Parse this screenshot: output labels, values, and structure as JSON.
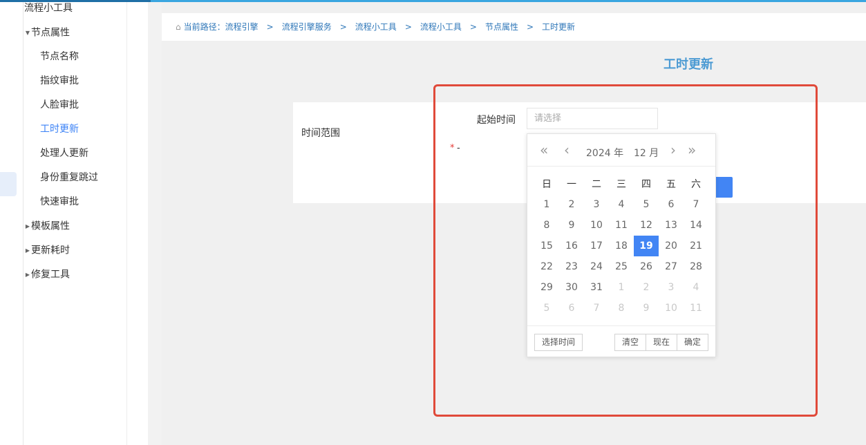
{
  "sidebar": {
    "root": "流程小工具",
    "groups": [
      {
        "label": "节点属性",
        "expanded": true,
        "items": [
          "节点名称",
          "指纹审批",
          "人脸审批",
          "工时更新",
          "处理人更新",
          "身份重复跳过",
          "快速审批"
        ]
      },
      {
        "label": "模板属性",
        "expanded": false
      },
      {
        "label": "更新耗时",
        "expanded": false
      },
      {
        "label": "修复工具",
        "expanded": false
      }
    ],
    "active_item": "工时更新"
  },
  "breadcrumb": {
    "prefix": "当前路径：",
    "items": [
      "流程引擎",
      "流程引擎服务",
      "流程小工具",
      "流程小工具",
      "节点属性",
      "工时更新"
    ],
    "separator": ">"
  },
  "page": {
    "title": "工时更新"
  },
  "form": {
    "range_label": "时间范围",
    "start_label": "起始时间",
    "start_placeholder": "请选择",
    "required_mark": "*",
    "dash": "-"
  },
  "datepicker": {
    "year": "2024 年",
    "month": "12 月",
    "nav": {
      "prev_year": "«",
      "prev_month": "‹",
      "next_month": "›",
      "next_year": "»"
    },
    "weekdays": [
      "日",
      "一",
      "二",
      "三",
      "四",
      "五",
      "六"
    ],
    "weeks": [
      [
        "1",
        "2",
        "3",
        "4",
        "5",
        "6",
        "7"
      ],
      [
        "8",
        "9",
        "10",
        "11",
        "12",
        "13",
        "14"
      ],
      [
        "15",
        "16",
        "17",
        "18",
        "19",
        "20",
        "21"
      ],
      [
        "22",
        "23",
        "24",
        "25",
        "26",
        "27",
        "28"
      ],
      [
        "29",
        "30",
        "31",
        "1",
        "2",
        "3",
        "4"
      ],
      [
        "5",
        "6",
        "7",
        "8",
        "9",
        "10",
        "11"
      ]
    ],
    "selected_day": "19",
    "footer": {
      "select_time": "选择时间",
      "clear": "清空",
      "now": "现在",
      "confirm": "确定"
    }
  },
  "colors": {
    "accent": "#4285f4",
    "highlight_border": "#e04a3a",
    "title_blue": "#4b9ad3",
    "breadcrumb_blue": "#2d76b8"
  }
}
